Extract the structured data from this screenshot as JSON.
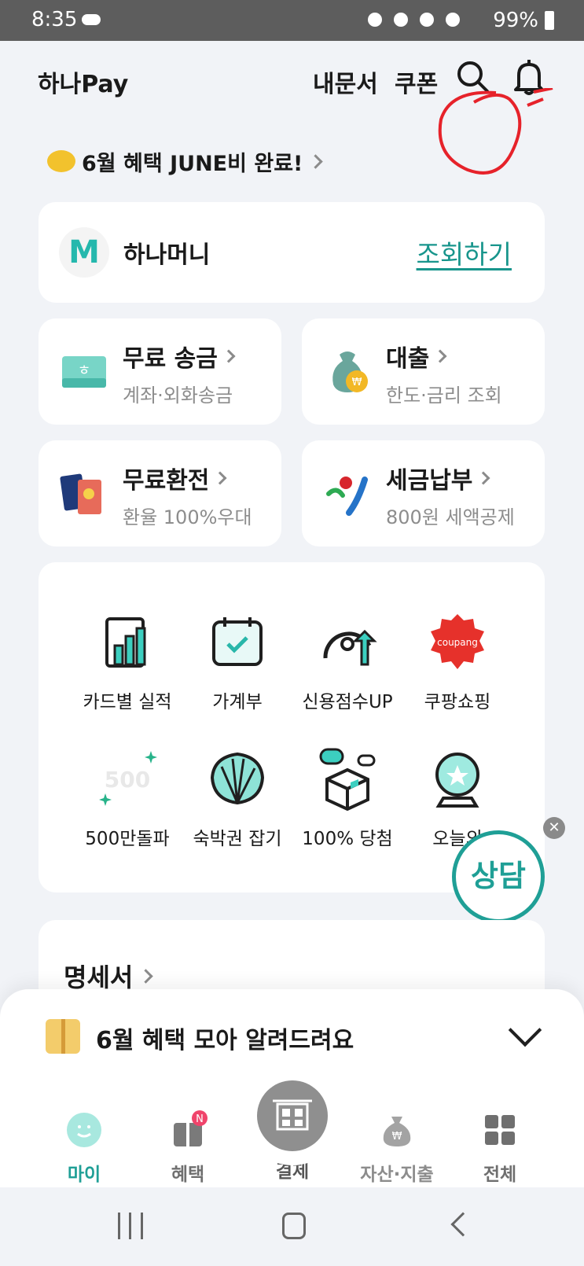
{
  "status_bar": {
    "time": "8:35",
    "battery": "99%"
  },
  "header": {
    "brand": "하나Pay",
    "statement_link": "내문서",
    "coupon_link": "쿠폰"
  },
  "promo": {
    "text": "6월 혜택 JUNE비 완료!"
  },
  "hana_money": {
    "logo": "M",
    "title": "하나머니",
    "action": "조회하기"
  },
  "quick_cards": [
    {
      "title": "무료 송금",
      "subtitle": "계좌·외화송금"
    },
    {
      "title": "대출",
      "subtitle": "한도·금리 조회"
    },
    {
      "title": "무료환전",
      "subtitle": "환율 100%우대"
    },
    {
      "title": "세금납부",
      "subtitle": "800원 세액공제"
    }
  ],
  "menu": [
    {
      "label": "카드별 실적"
    },
    {
      "label": "가계부"
    },
    {
      "label": "신용점수UP"
    },
    {
      "label": "쿠팡쇼핑",
      "logo_text": "coupang"
    },
    {
      "label": "500만돌파",
      "badge_text": "500"
    },
    {
      "label": "숙박권 잡기"
    },
    {
      "label": "100% 당첨"
    },
    {
      "label": "오늘의"
    }
  ],
  "consult_button": "상담",
  "statement_section": {
    "title": "명세서"
  },
  "bottom_sheet": {
    "text": "6월 혜택 모아 알려드려요"
  },
  "tabs": [
    {
      "label": "마이",
      "active": true
    },
    {
      "label": "혜택",
      "badge": "N"
    },
    {
      "label": "결제"
    },
    {
      "label": "자산·지출"
    },
    {
      "label": "전체"
    }
  ],
  "colors": {
    "accent": "#1f9f96",
    "background": "#f1f3f7",
    "status_bar": "#5d5d5d"
  }
}
